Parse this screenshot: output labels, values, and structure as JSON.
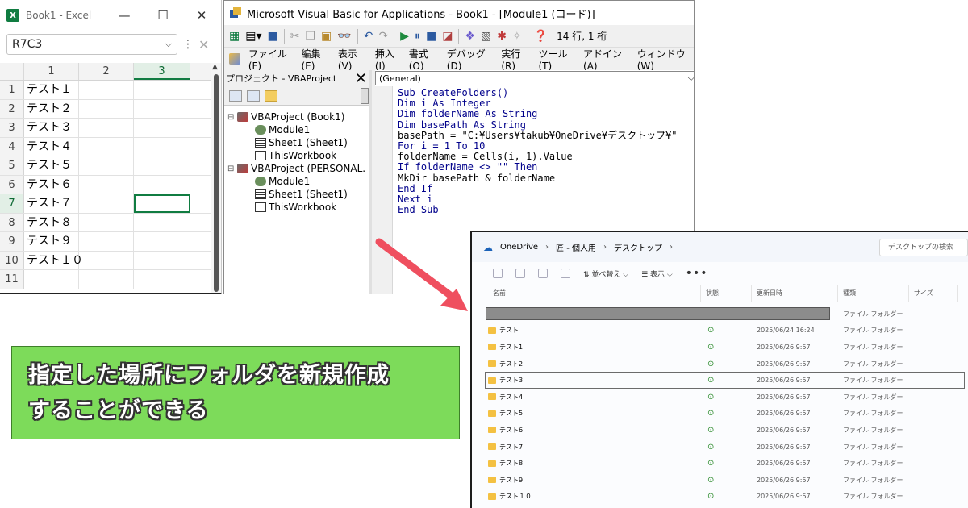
{
  "excel": {
    "title": "Book1 - Excel",
    "logo_letter": "X",
    "name_box": "R7C3",
    "columns": [
      "1",
      "2",
      "3"
    ],
    "rows": [
      {
        "n": "1",
        "v": "テスト１"
      },
      {
        "n": "2",
        "v": "テスト２"
      },
      {
        "n": "3",
        "v": "テスト３"
      },
      {
        "n": "4",
        "v": "テスト４"
      },
      {
        "n": "5",
        "v": "テスト５"
      },
      {
        "n": "6",
        "v": "テスト６"
      },
      {
        "n": "7",
        "v": "テスト７"
      },
      {
        "n": "8",
        "v": "テスト８"
      },
      {
        "n": "9",
        "v": "テスト９"
      },
      {
        "n": "10",
        "v": "テスト１０"
      },
      {
        "n": "11",
        "v": ""
      }
    ],
    "accent": "#107c41"
  },
  "vbe": {
    "title": "Microsoft Visual Basic for Applications - Book1 - [Module1 (コード)]",
    "cursor_pos": "14 行, 1 桁",
    "menu": [
      "ファイル(F)",
      "編集(E)",
      "表示(V)",
      "挿入(I)",
      "書式(O)",
      "デバッグ(D)",
      "実行(R)",
      "ツール(T)",
      "アドイン(A)",
      "ウィンドウ(W)"
    ],
    "project_title": "プロジェクト - VBAProject",
    "tree": {
      "proj1": "VBAProject (Book1)",
      "module1": "Module1",
      "sheet1": "Sheet1 (Sheet1)",
      "thisworkbook1": "ThisWorkbook",
      "proj2": "VBAProject (PERSONAL.",
      "module2": "Module1",
      "sheet2": "Sheet1 (Sheet1)",
      "thisworkbook2": "ThisWorkbook"
    },
    "combo": "(General)",
    "code": [
      "Sub CreateFolders()",
      "Dim i As Integer",
      "Dim folderName As String",
      "Dim basePath As String",
      "basePath = \"C:¥Users¥takub¥OneDrive¥デスクトップ¥\"",
      "For i = 1 To 10",
      "folderName = Cells(i, 1).Value",
      "If folderName <> \"\" Then",
      "MkDir basePath & folderName",
      "End If",
      "Next i",
      "End Sub"
    ]
  },
  "caption": {
    "line1": "指定した場所にフォルダを新規作成",
    "line2": "することができる",
    "bg_color": "#7ddb5a"
  },
  "explorer": {
    "breadcrumb": [
      "OneDrive",
      "匠 - 個人用",
      "デスクトップ"
    ],
    "search_placeholder": "デスクトップの検索",
    "sort_label": "並べ替え",
    "view_label": "表示",
    "more_label": "•••",
    "headers": {
      "name": "名前",
      "status": "状態",
      "date": "更新日時",
      "type": "種類",
      "size": "サイズ"
    },
    "redacted_type": "ファイル フォルダー",
    "files": [
      {
        "name": "テスト",
        "date": "2025/06/24 16:24",
        "type": "ファイル フォルダー"
      },
      {
        "name": "テスト1",
        "date": "2025/06/26 9:57",
        "type": "ファイル フォルダー"
      },
      {
        "name": "テスト2",
        "date": "2025/06/26 9:57",
        "type": "ファイル フォルダー"
      },
      {
        "name": "テスト3",
        "date": "2025/06/26 9:57",
        "type": "ファイル フォルダー"
      },
      {
        "name": "テスト4",
        "date": "2025/06/26 9:57",
        "type": "ファイル フォルダー"
      },
      {
        "name": "テスト5",
        "date": "2025/06/26 9:57",
        "type": "ファイル フォルダー"
      },
      {
        "name": "テスト6",
        "date": "2025/06/26 9:57",
        "type": "ファイル フォルダー"
      },
      {
        "name": "テスト7",
        "date": "2025/06/26 9:57",
        "type": "ファイル フォルダー"
      },
      {
        "name": "テスト8",
        "date": "2025/06/26 9:57",
        "type": "ファイル フォルダー"
      },
      {
        "name": "テスト9",
        "date": "2025/06/26 9:57",
        "type": "ファイル フォルダー"
      },
      {
        "name": "テスト１０",
        "date": "2025/06/26 9:57",
        "type": "ファイル フォルダー"
      }
    ],
    "status_icon": "sync-check-icon",
    "arrow_color": "#ef4f5f"
  }
}
